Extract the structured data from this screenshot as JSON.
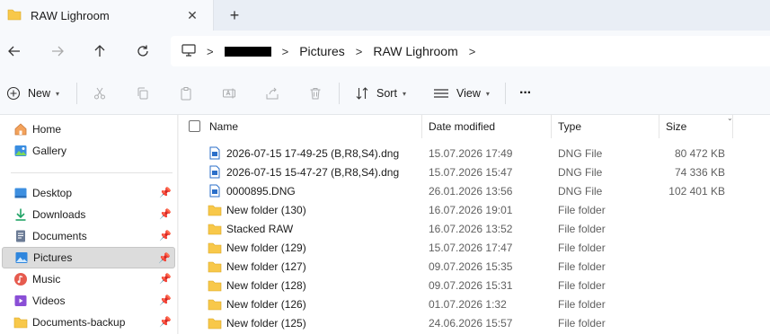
{
  "window": {
    "tab_title": "RAW Lighroom"
  },
  "address": {
    "crumbs": [
      "Pictures",
      "RAW Lighroom"
    ]
  },
  "commands": {
    "new_label": "New",
    "sort_label": "Sort",
    "view_label": "View",
    "more_label": "···"
  },
  "sidebar": {
    "items": [
      {
        "label": "Home",
        "icon": "home-icon"
      },
      {
        "label": "Gallery",
        "icon": "gallery-icon"
      },
      {
        "label": "Desktop",
        "icon": "desktop-icon"
      },
      {
        "label": "Downloads",
        "icon": "downloads-icon"
      },
      {
        "label": "Documents",
        "icon": "documents-icon"
      },
      {
        "label": "Pictures",
        "icon": "pictures-icon"
      },
      {
        "label": "Music",
        "icon": "music-icon"
      },
      {
        "label": "Videos",
        "icon": "videos-icon"
      },
      {
        "label": "Documents-backup",
        "icon": "folder-icon"
      }
    ],
    "selected": "Pictures"
  },
  "columns": {
    "name": "Name",
    "date": "Date modified",
    "type": "Type",
    "size": "Size"
  },
  "files": [
    {
      "name": "2026-07-15 17-49-25 (B,R8,S4).dng",
      "date": "15.07.2026 17:49",
      "type": "DNG File",
      "size": "80 472 KB",
      "kind": "dng"
    },
    {
      "name": "2026-07-15 15-47-27 (B,R8,S4).dng",
      "date": "15.07.2026 15:47",
      "type": "DNG File",
      "size": "74 336 KB",
      "kind": "dng"
    },
    {
      "name": "0000895.DNG",
      "date": "26.01.2026 13:56",
      "type": "DNG File",
      "size": "102 401 KB",
      "kind": "dng"
    },
    {
      "name": "New folder (130)",
      "date": "16.07.2026 19:01",
      "type": "File folder",
      "size": "",
      "kind": "folder"
    },
    {
      "name": "Stacked RAW",
      "date": "16.07.2026 13:52",
      "type": "File folder",
      "size": "",
      "kind": "folder"
    },
    {
      "name": "New folder (129)",
      "date": "15.07.2026 17:47",
      "type": "File folder",
      "size": "",
      "kind": "folder"
    },
    {
      "name": "New folder (127)",
      "date": "09.07.2026 15:35",
      "type": "File folder",
      "size": "",
      "kind": "folder"
    },
    {
      "name": "New folder (128)",
      "date": "09.07.2026 15:31",
      "type": "File folder",
      "size": "",
      "kind": "folder"
    },
    {
      "name": "New folder (126)",
      "date": "01.07.2026 1:32",
      "type": "File folder",
      "size": "",
      "kind": "folder"
    },
    {
      "name": "New folder (125)",
      "date": "24.06.2026 15:57",
      "type": "File folder",
      "size": "",
      "kind": "folder"
    }
  ],
  "colors": {
    "folder": "#f8c84a",
    "accent": "#2b6fc9"
  }
}
